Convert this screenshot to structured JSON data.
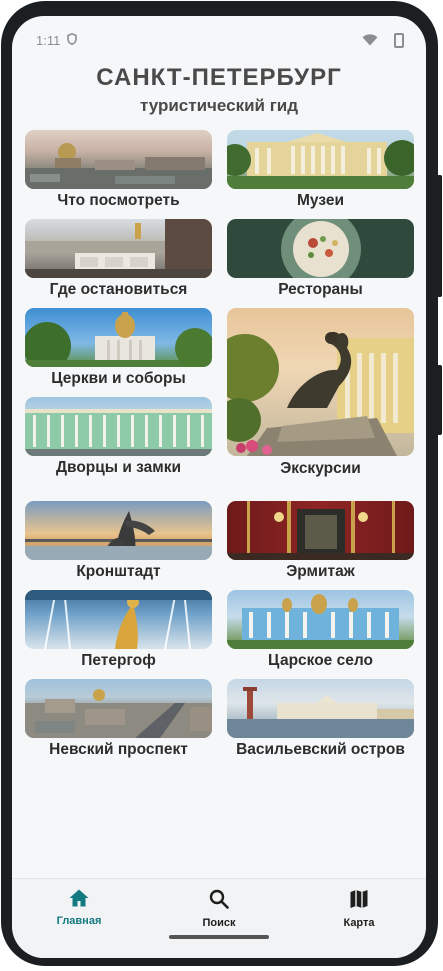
{
  "status_bar": {
    "time": "1:11"
  },
  "header": {
    "title": "САНКТ-ПЕТЕРБУРГ",
    "subtitle": "туристический гид"
  },
  "tiles": [
    {
      "label": "Что посмотреть",
      "image": "city-panorama"
    },
    {
      "label": "Музеи",
      "image": "museum-facade"
    },
    {
      "label": "Где остановиться",
      "image": "hotel-terrace"
    },
    {
      "label": "Рестораны",
      "image": "restaurant-dish"
    },
    {
      "label": "Церкви и соборы",
      "image": "cathedral"
    },
    {
      "label": "Экскурсии",
      "image": "bronze-horseman"
    },
    {
      "label": "Дворцы и замки",
      "image": "palace"
    },
    {
      "label": "Кронштадт",
      "image": "kronstadt-sunset"
    },
    {
      "label": "Эрмитаж",
      "image": "hermitage-hall"
    },
    {
      "label": "Петергоф",
      "image": "peterhof-fountain"
    },
    {
      "label": "Царское село",
      "image": "catherine-palace"
    },
    {
      "label": "Невский проспект",
      "image": "nevsky-aerial"
    },
    {
      "label": "Васильевский остров",
      "image": "strelka-columns"
    }
  ],
  "bottom_nav": [
    {
      "label": "Главная",
      "icon": "home-icon",
      "active": true
    },
    {
      "label": "Поиск",
      "icon": "search-icon",
      "active": false
    },
    {
      "label": "Карта",
      "icon": "map-icon",
      "active": false
    }
  ],
  "colors": {
    "accent": "#127a80",
    "background": "#f5f7f9",
    "text": "#2d2d2d"
  }
}
